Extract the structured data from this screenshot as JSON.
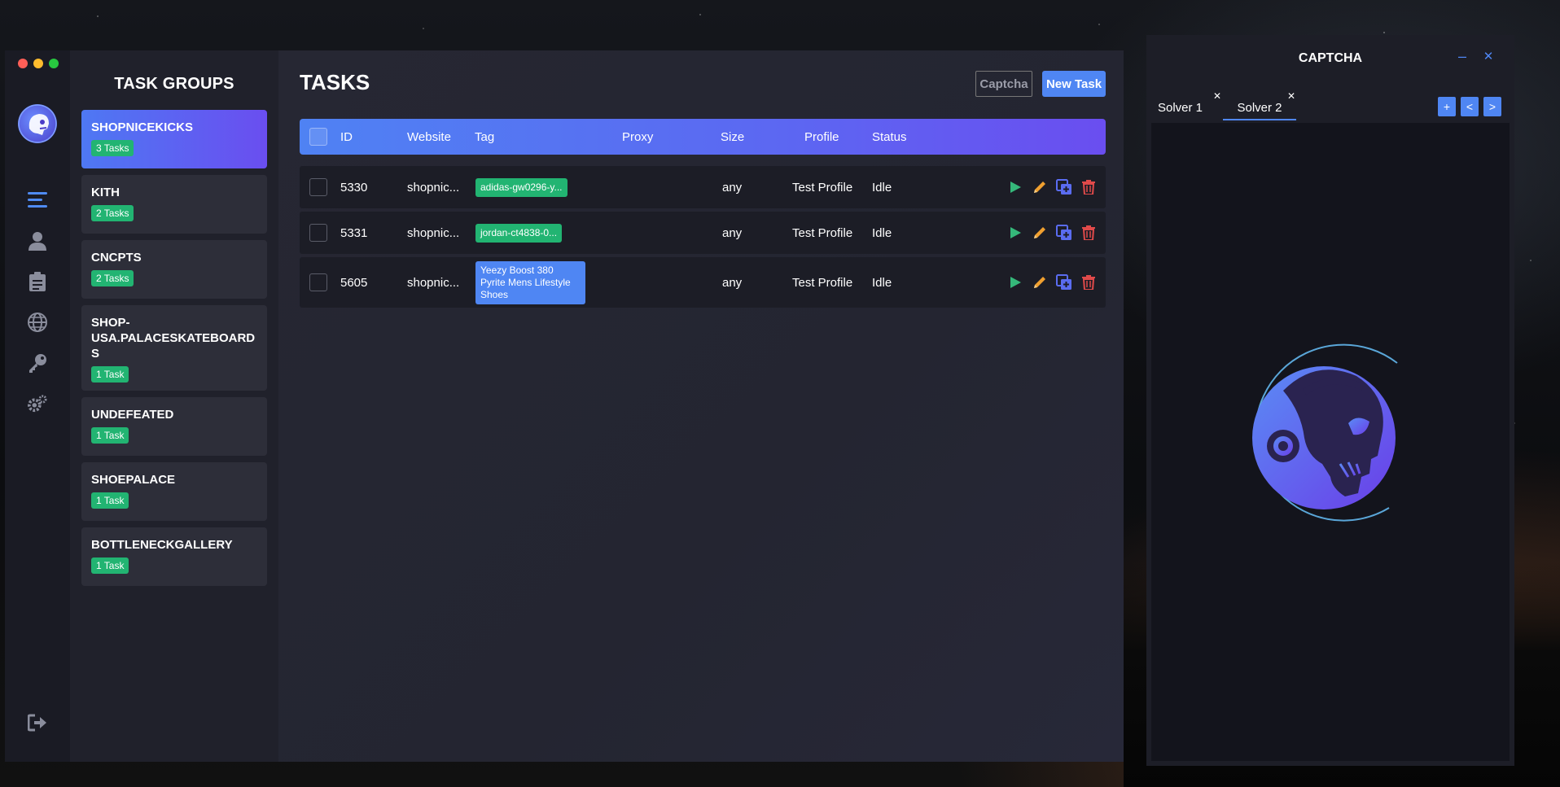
{
  "app": {
    "window_controls": {
      "colors": [
        "#ff5f57",
        "#febc2e",
        "#28c840"
      ]
    },
    "nav": {
      "icons": [
        "tasks-icon",
        "profile-icon",
        "clipboard-icon",
        "globe-icon",
        "key-icon",
        "settings-icon",
        "logout-icon"
      ],
      "active": "tasks-icon"
    },
    "groups_title": "TASK GROUPS",
    "groups": [
      {
        "name": "SHOPNICEKICKS",
        "count": "3 Tasks",
        "active": true
      },
      {
        "name": "KITH",
        "count": "2 Tasks"
      },
      {
        "name": "CNCPTS",
        "count": "2 Tasks"
      },
      {
        "name": "SHOP-USA.PALACESKATEBOARDS",
        "count": "1 Task"
      },
      {
        "name": "UNDEFEATED",
        "count": "1 Task"
      },
      {
        "name": "SHOEPALACE",
        "count": "1 Task"
      },
      {
        "name": "BOTTLENECKGALLERY",
        "count": "1 Task"
      }
    ],
    "tasks_title": "TASKS",
    "captcha_button": "Captcha",
    "new_task_button": "New Task",
    "columns": {
      "id": "ID",
      "website": "Website",
      "tag": "Tag",
      "proxy": "Proxy",
      "size": "Size",
      "profile": "Profile",
      "status": "Status"
    },
    "rows": [
      {
        "id": "5330",
        "website": "shopnic...",
        "tag": "adidas-gw0296-y...",
        "tag_color": "green",
        "proxy": "",
        "size": "any",
        "profile": "Test Profile",
        "status": "Idle"
      },
      {
        "id": "5331",
        "website": "shopnic...",
        "tag": "jordan-ct4838-0...",
        "tag_color": "green",
        "proxy": "",
        "size": "any",
        "profile": "Test Profile",
        "status": "Idle"
      },
      {
        "id": "5605",
        "website": "shopnic...",
        "tag": "Yeezy Boost 380 Pyrite Mens Lifestyle Shoes",
        "tag_color": "blue",
        "proxy": "",
        "size": "any",
        "profile": "Test Profile",
        "status": "Idle"
      }
    ],
    "row_actions": [
      "play-icon",
      "edit-icon",
      "duplicate-icon",
      "delete-icon"
    ],
    "colors": {
      "accent": "#4f86f3",
      "accent2": "#6a4ef0",
      "green": "#22b472",
      "play": "#35b87a",
      "edit": "#f0a030",
      "duplicate": "#5a6cf0",
      "delete": "#e04a4a"
    }
  },
  "captcha": {
    "title": "CAPTCHA",
    "minimize": "–",
    "close": "✕",
    "tabs": [
      {
        "label": "Solver 1",
        "close": "✕"
      },
      {
        "label": "Solver 2",
        "close": "✕",
        "active": true
      }
    ],
    "buttons": {
      "add": "+",
      "prev": "<",
      "next": ">"
    }
  }
}
